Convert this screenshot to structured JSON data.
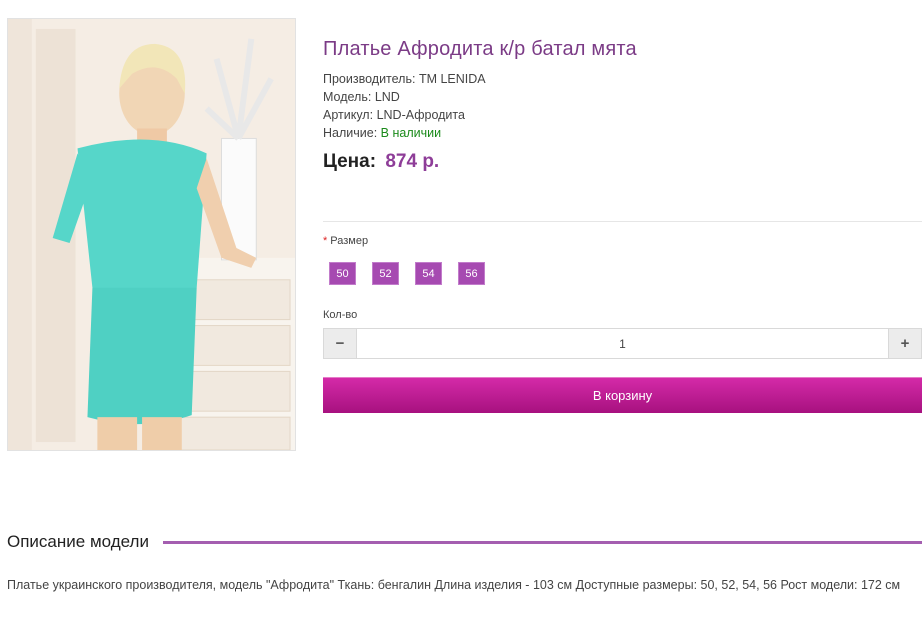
{
  "product": {
    "title": "Платье Афродита к/р батал мята",
    "manufacturer_label": "Производитель:",
    "manufacturer": "TM LENIDA",
    "model_label": "Модель:",
    "model": "LND",
    "sku_label": "Артикул:",
    "sku": "LND-Афродита",
    "availability_label": "Наличие:",
    "availability": "В наличии",
    "price_label": "Цена:",
    "price": "874 р."
  },
  "options": {
    "required_mark": "*",
    "size_label": "Размер",
    "sizes": [
      "50",
      "52",
      "54",
      "56"
    ]
  },
  "quantity": {
    "label": "Кол-во",
    "minus": "−",
    "plus": "+",
    "value": "1"
  },
  "cart": {
    "button_label": "В корзину"
  },
  "description": {
    "heading": "Описание модели",
    "text": "Платье украинского производителя, модель \"Афродита\" Ткань: бенгалин Длина изделия - 103 см Доступные размеры: 50, 52, 54, 56 Рост модели: 172 см"
  },
  "colors": {
    "title": "#7b3b86",
    "price": "#8e3d98",
    "size_button": "#a64ab1",
    "cart_button": "#c21d98",
    "in_stock": "#1a8a1a",
    "heading_rule": "#a45eb0"
  }
}
